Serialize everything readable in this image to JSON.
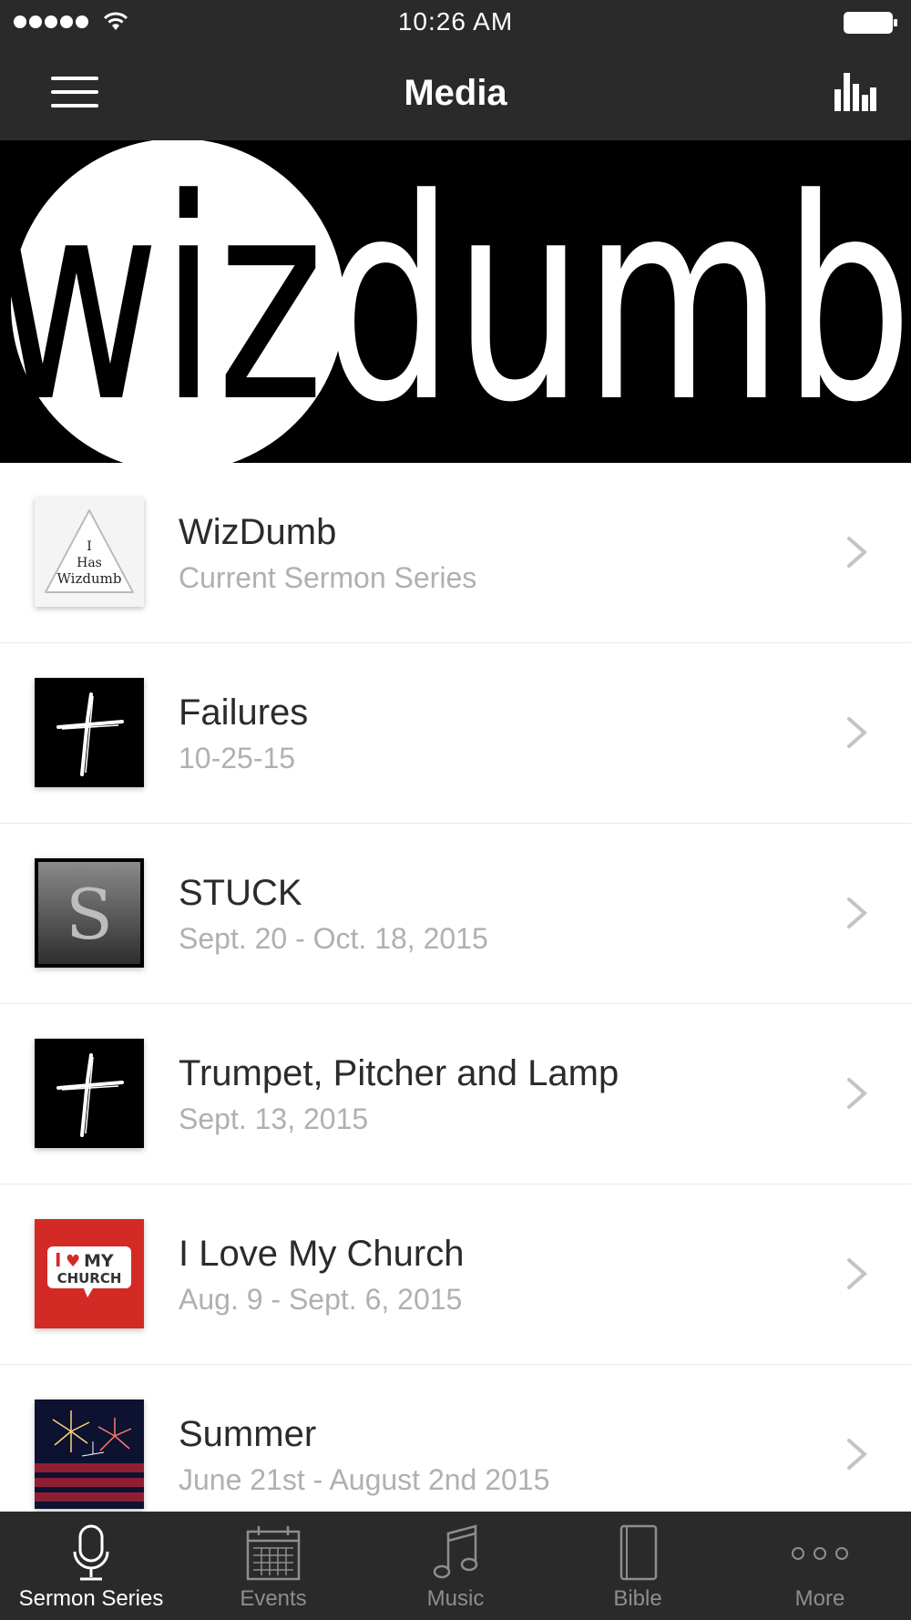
{
  "status_bar": {
    "time": "10:26 AM"
  },
  "nav": {
    "title": "Media",
    "menu_icon": "hamburger-icon",
    "right_icon": "bar-chart-icon"
  },
  "banner": {
    "logo_text": "wizdumb"
  },
  "series": [
    {
      "title": "WizDumb",
      "subtitle": "Current Sermon Series",
      "thumb_lines": [
        "I",
        "Has",
        "Wizdumb"
      ]
    },
    {
      "title": "Failures",
      "subtitle": "10-25-15"
    },
    {
      "title": "STUCK",
      "subtitle": "Sept. 20 - Oct. 18, 2015",
      "thumb_letter": "S"
    },
    {
      "title": "Trumpet, Pitcher and Lamp",
      "subtitle": "Sept. 13, 2015"
    },
    {
      "title": "I Love My Church",
      "subtitle": "Aug. 9 - Sept. 6, 2015",
      "thumb_text_1": "I",
      "thumb_text_heart": "♥",
      "thumb_text_2": "MY",
      "thumb_text_3": "CHURCH"
    },
    {
      "title": "Summer",
      "subtitle": "June 21st - August 2nd 2015"
    }
  ],
  "tabs": [
    {
      "label": "Sermon Series",
      "icon": "microphone-icon",
      "active": true
    },
    {
      "label": "Events",
      "icon": "calendar-icon",
      "active": false
    },
    {
      "label": "Music",
      "icon": "music-note-icon",
      "active": false
    },
    {
      "label": "Bible",
      "icon": "book-icon",
      "active": false
    },
    {
      "label": "More",
      "icon": "more-dots-icon",
      "active": false
    }
  ],
  "colors": {
    "bar_bg": "#2a2a2a",
    "active_tab": "#ffffff",
    "inactive_tab": "#8e8e8e",
    "subtitle": "#b0b0b0"
  }
}
